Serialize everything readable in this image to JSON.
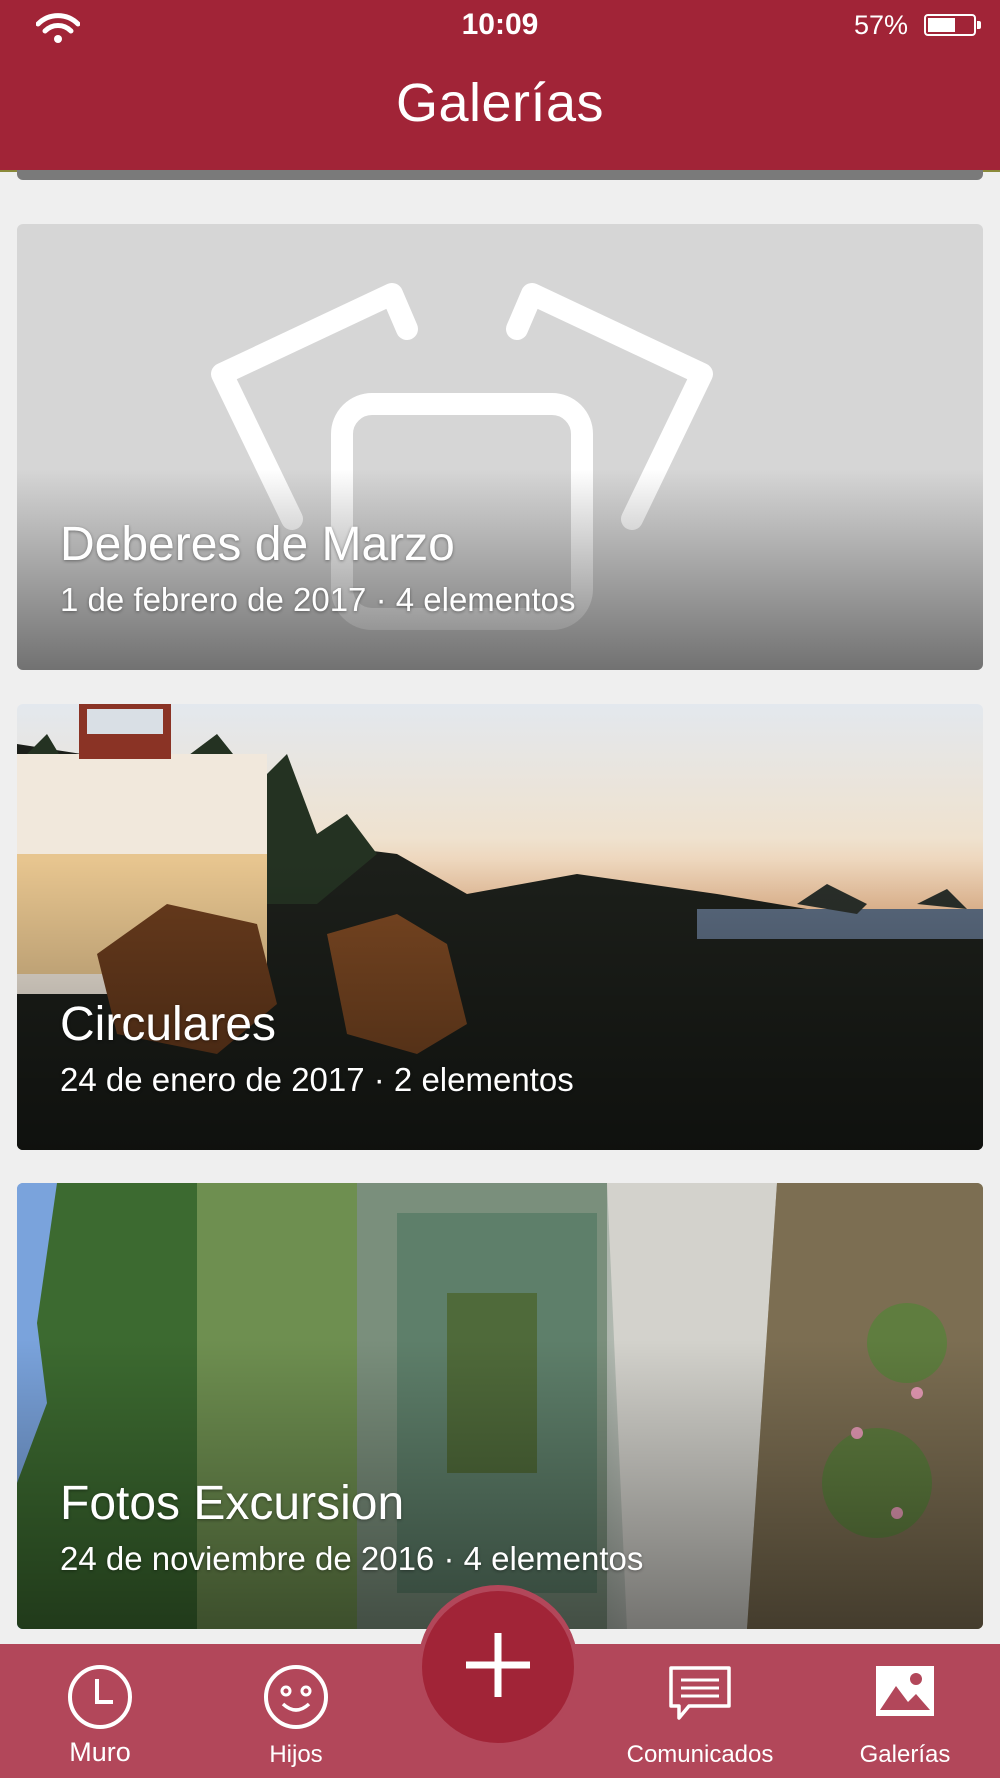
{
  "status_bar": {
    "time": "10:09",
    "battery": "57%",
    "battery_level": 0.57
  },
  "header": {
    "title": "Galerías"
  },
  "galleries": [
    {
      "title": "Deberes de Marzo",
      "meta": "1 de febrero de 2017 · 4 elementos"
    },
    {
      "title": "Circulares",
      "meta": "24 de enero de 2017 · 2 elementos"
    },
    {
      "title": "Fotos Excursion",
      "meta": "24 de noviembre de 2016 · 4 elementos"
    }
  ],
  "tab_bar": {
    "tabs": [
      {
        "label": "Muro",
        "icon": "clock-icon"
      },
      {
        "label": "Hijos",
        "icon": "smiley-icon"
      },
      {
        "label": "Comunicados",
        "icon": "chat-icon"
      },
      {
        "label": "Galerías",
        "icon": "image-icon"
      }
    ],
    "add_icon": "plus-icon"
  },
  "colors": {
    "brand": "#a12437",
    "tab_bar": "#b2475a",
    "background": "#efefef"
  }
}
